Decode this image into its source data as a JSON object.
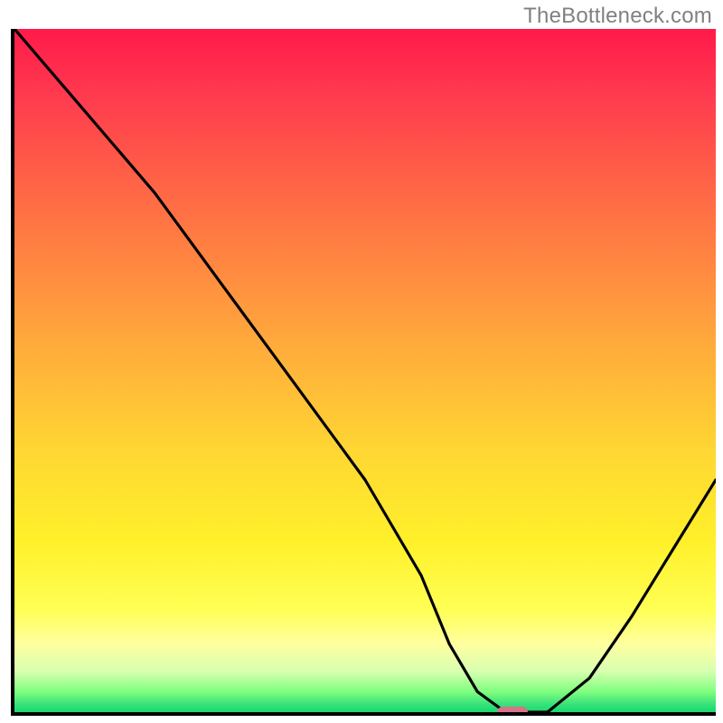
{
  "watermark": "TheBottleneck.com",
  "colors": {
    "line": "#000000",
    "marker": "#d9718b",
    "gradient_top": "#ff1a4b",
    "gradient_bottom": "#19d96b",
    "frame": "#000000"
  },
  "chart_data": {
    "type": "line",
    "title": "",
    "xlabel": "",
    "ylabel": "",
    "xlim": [
      0,
      100
    ],
    "ylim": [
      0,
      100
    ],
    "x": [
      0,
      5,
      10,
      15,
      20,
      30,
      40,
      50,
      58,
      62,
      66,
      70,
      76,
      82,
      88,
      94,
      100
    ],
    "values": [
      100,
      94,
      88,
      82,
      76,
      62,
      48,
      34,
      20,
      10,
      3,
      0,
      0,
      5,
      14,
      24,
      34
    ],
    "marker": {
      "x": 71,
      "y": 0
    },
    "notes": "Values are estimated from pixel positions; no axis ticks or numeric labels are present in the original image."
  }
}
